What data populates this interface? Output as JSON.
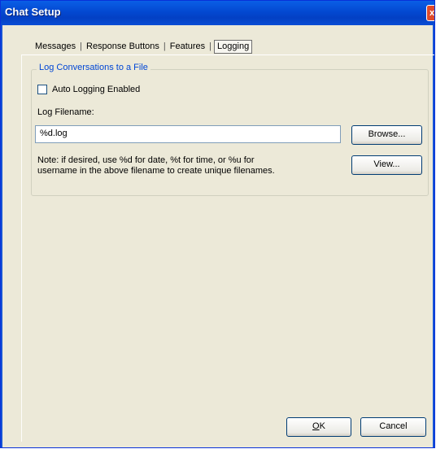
{
  "window": {
    "title": "Chat Setup",
    "close_glyph": "x",
    "icon_name": "close-icon"
  },
  "tabs": [
    {
      "label": "Messages"
    },
    {
      "label": "Response Buttons"
    },
    {
      "label": "Features"
    },
    {
      "label": "Logging",
      "active": true
    }
  ],
  "tab_separator": "|",
  "logging": {
    "group_title": "Log Conversations to a File",
    "auto_logging_label": "Auto Logging Enabled",
    "auto_logging_checked": false,
    "filename_label": "Log Filename:",
    "filename_value": "%d.log",
    "browse_label": "Browse...",
    "view_label": "View...",
    "note_line1": "Note: if desired, use %d for date, %t for time, or %u for",
    "note_line2": "username in the above filename to create unique filenames."
  },
  "footer": {
    "ok_accel": "O",
    "ok_rest": "K",
    "cancel_label": "Cancel"
  },
  "colors": {
    "title_bar": "#0348d1",
    "dialog_bg": "#ece9d8",
    "group_title": "#0046d5"
  }
}
